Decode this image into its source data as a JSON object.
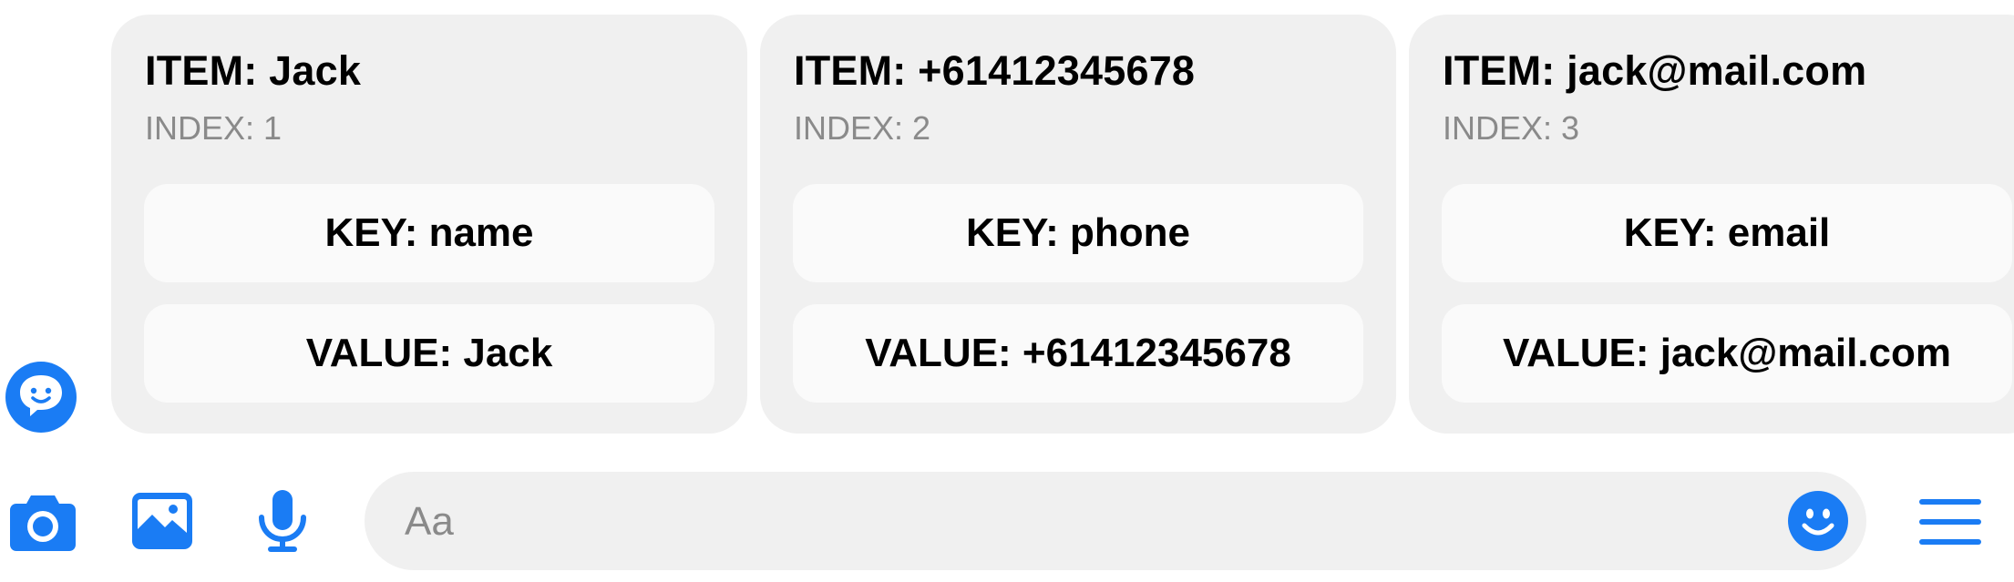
{
  "carousel": {
    "cards": [
      {
        "title": "ITEM: Jack",
        "subtitle": "INDEX: 1",
        "key_button": "KEY: name",
        "value_button": "VALUE: Jack"
      },
      {
        "title": "ITEM: +61412345678",
        "subtitle": "INDEX: 2",
        "key_button": "KEY: phone",
        "value_button": "VALUE: +61412345678"
      },
      {
        "title": "ITEM: jack@mail.com",
        "subtitle": "INDEX: 3",
        "key_button": "KEY: email",
        "value_button": "VALUE: jack@mail.com"
      }
    ]
  },
  "composer": {
    "placeholder": "Aa",
    "icons": [
      "camera-icon",
      "photo-icon",
      "microphone-icon",
      "emoji-icon",
      "menu-icon"
    ]
  },
  "bot_avatar": {
    "icon": "chat-bot-icon"
  },
  "colors": {
    "accent": "#1a7cf4",
    "card_bg": "#f0f0f0",
    "button_bg": "#fafafa",
    "muted_text": "#8a8a8a"
  }
}
